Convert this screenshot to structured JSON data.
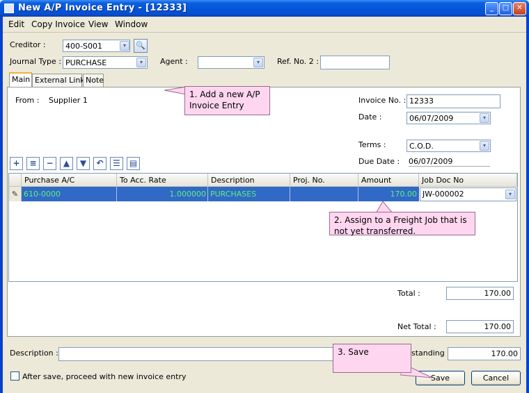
{
  "window": {
    "title": "New A/P Invoice Entry - [12333]",
    "minimize": "_",
    "maximize": "□",
    "close": "✕"
  },
  "menu": {
    "edit": "Edit",
    "copy": "Copy Invoice",
    "view": "View",
    "window": "Window"
  },
  "header": {
    "creditor_label": "Creditor :",
    "creditor_value": "400-S001",
    "journal_label": "Journal Type :",
    "journal_value": "PURCHASE",
    "agent_label": "Agent :",
    "agent_value": "",
    "refno_label": "Ref. No. 2 :",
    "refno_value": ""
  },
  "tabs": [
    "Main",
    "External Links",
    "Note"
  ],
  "main": {
    "from_label": "From :",
    "from_value": "Supplier 1",
    "invoice_label": "Invoice No. :",
    "invoice_value": "12333",
    "date_label": "Date :",
    "date_value": "06/07/2009",
    "terms_label": "Terms :",
    "terms_value": "C.O.D.",
    "due_label": "Due Date :",
    "due_value": "06/07/2009"
  },
  "grid": {
    "columns": [
      "Purchase A/C",
      "To Acc. Rate",
      "Description",
      "Proj. No.",
      "Amount",
      "Job Doc No"
    ],
    "row": {
      "account": "610-0000",
      "rate": "1.000000",
      "description": "PURCHASES",
      "proj": "",
      "amount": "170.00",
      "job": "JW-000002"
    }
  },
  "totals": {
    "total_label": "Total :",
    "total_value": "170.00",
    "net_label": "Net Total :",
    "net_value": "170.00"
  },
  "footer": {
    "description_label": "Description :",
    "description_value": "",
    "outstanding_label": "standing :",
    "outstanding_value": "170.00",
    "checkbox_label": "After save, proceed with new invoice entry",
    "save": "Save",
    "cancel": "Cancel"
  },
  "callouts": {
    "c1": "1. Add a new A/P Invoice Entry",
    "c2": "2. Assign to a Freight Job that is not yet transferred.",
    "c3": "3. Save"
  },
  "icons": {
    "dropdown": "▾",
    "search": "🔍"
  }
}
